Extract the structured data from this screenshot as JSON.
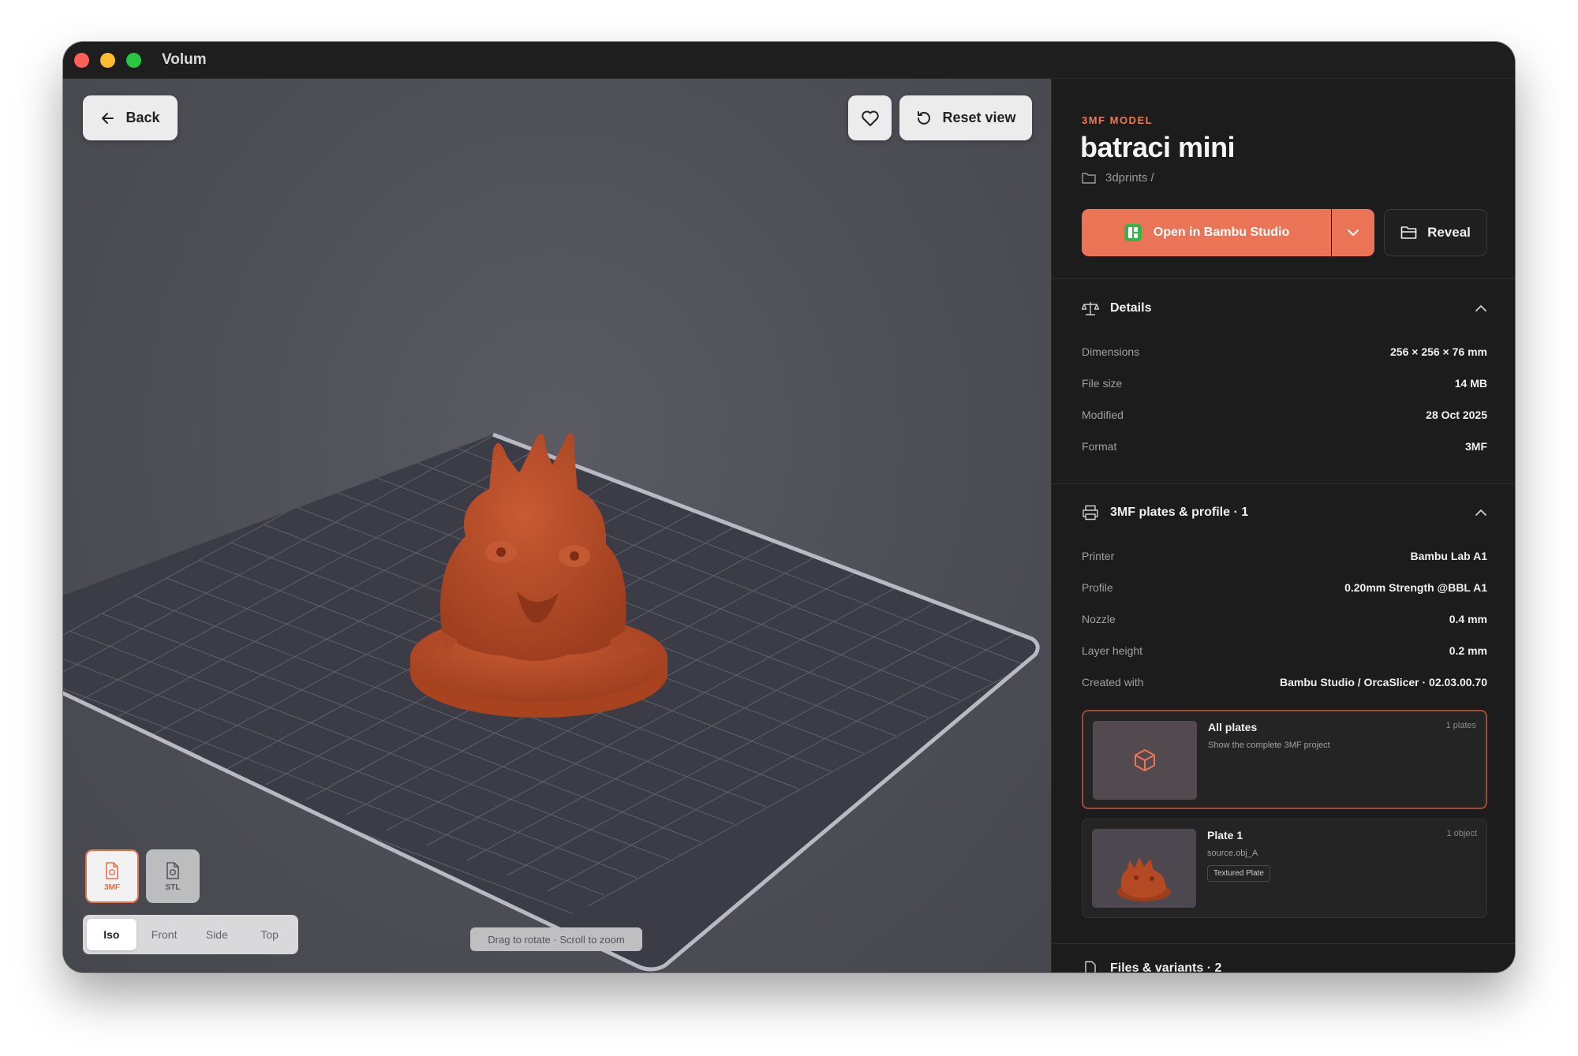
{
  "window": {
    "title": "Volum"
  },
  "viewer": {
    "back_label": "Back",
    "reset_label": "Reset view",
    "formats": [
      {
        "label": "3MF",
        "active": true
      },
      {
        "label": "STL",
        "active": false
      }
    ],
    "views": [
      "Iso",
      "Front",
      "Side",
      "Top"
    ],
    "active_view": "Iso",
    "hint": "Drag to rotate · Scroll to zoom",
    "model_color": "#b84a27"
  },
  "model": {
    "kind": "3MF MODEL",
    "name": "batraci mini",
    "path": "3dprints /",
    "open_label": "Open in Bambu Studio",
    "reveal_label": "Reveal",
    "accent": "#ec7456"
  },
  "details": {
    "title": "Details",
    "rows": [
      {
        "k": "Dimensions",
        "v": "256 × 256 × 76 mm"
      },
      {
        "k": "File size",
        "v": "14 MB"
      },
      {
        "k": "Modified",
        "v": "28 Oct 2025"
      },
      {
        "k": "Format",
        "v": "3MF"
      }
    ]
  },
  "plates": {
    "title": "3MF plates & profile · 1",
    "rows": [
      {
        "k": "Printer",
        "v": "Bambu Lab A1"
      },
      {
        "k": "Profile",
        "v": "0.20mm Strength @BBL A1"
      },
      {
        "k": "Nozzle",
        "v": "0.4 mm"
      },
      {
        "k": "Layer height",
        "v": "0.2 mm"
      },
      {
        "k": "Created with",
        "v": "Bambu Studio / OrcaSlicer · 02.03.00.70"
      }
    ],
    "cards": [
      {
        "title": "All plates",
        "sub": "Show the complete 3MF project",
        "count": "1 plates",
        "tag": ""
      },
      {
        "title": "Plate 1",
        "sub": "source.obj_A",
        "count": "1 object",
        "tag": "Textured Plate"
      }
    ]
  },
  "files": {
    "title": "Files & variants · 2"
  }
}
